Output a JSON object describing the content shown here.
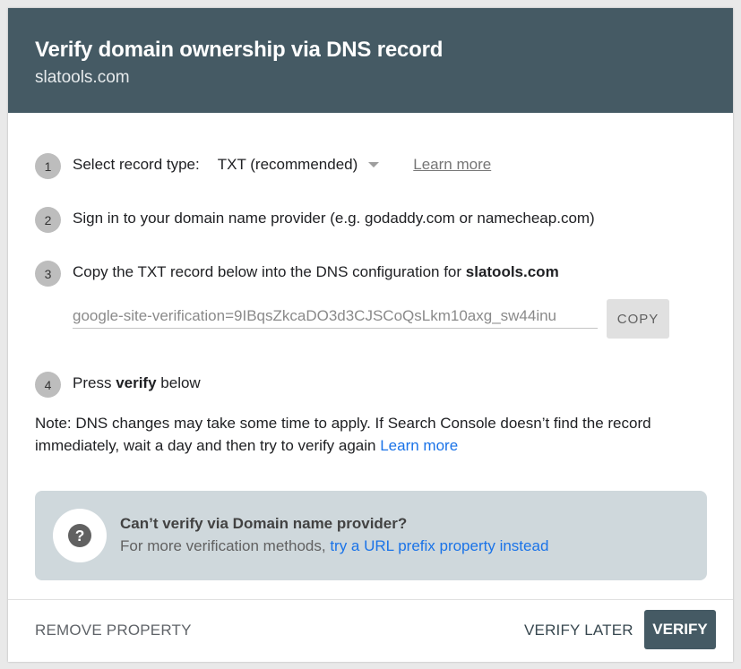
{
  "header": {
    "title": "Verify domain ownership via DNS record",
    "subtitle": "slatools.com"
  },
  "steps": [
    {
      "number": "1",
      "label": "Select record type:",
      "select_value": "TXT (recommended)",
      "learn_more": "Learn more"
    },
    {
      "number": "2",
      "text": "Sign in to your domain name provider (e.g. godaddy.com or namecheap.com)"
    },
    {
      "number": "3",
      "text": "Copy the TXT record below into the DNS configuration for ",
      "domain": "slatools.com",
      "record_value": "google-site-verification=9IBqsZkcaDO3d3CJSCoQsLkm10axg_sw44inu",
      "copy_label": "COPY"
    },
    {
      "number": "4",
      "text_before": "Press ",
      "bold": "verify",
      "text_after": " below"
    }
  ],
  "note": {
    "text": "Note: DNS changes may take some time to apply. If Search Console doesn’t find the record immediately, wait a day and then try to verify again ",
    "link": "Learn more"
  },
  "help": {
    "icon": "question-circle-icon",
    "title": "Can’t verify via Domain name provider?",
    "text": "For more verification methods, ",
    "link": "try a URL prefix property instead"
  },
  "footer": {
    "remove_label": "REMOVE PROPERTY",
    "later_label": "VERIFY LATER",
    "verify_label": "VERIFY"
  },
  "colors": {
    "header_bg": "#455a64",
    "link": "#1a73e8",
    "help_bg": "#cfd8dc"
  }
}
